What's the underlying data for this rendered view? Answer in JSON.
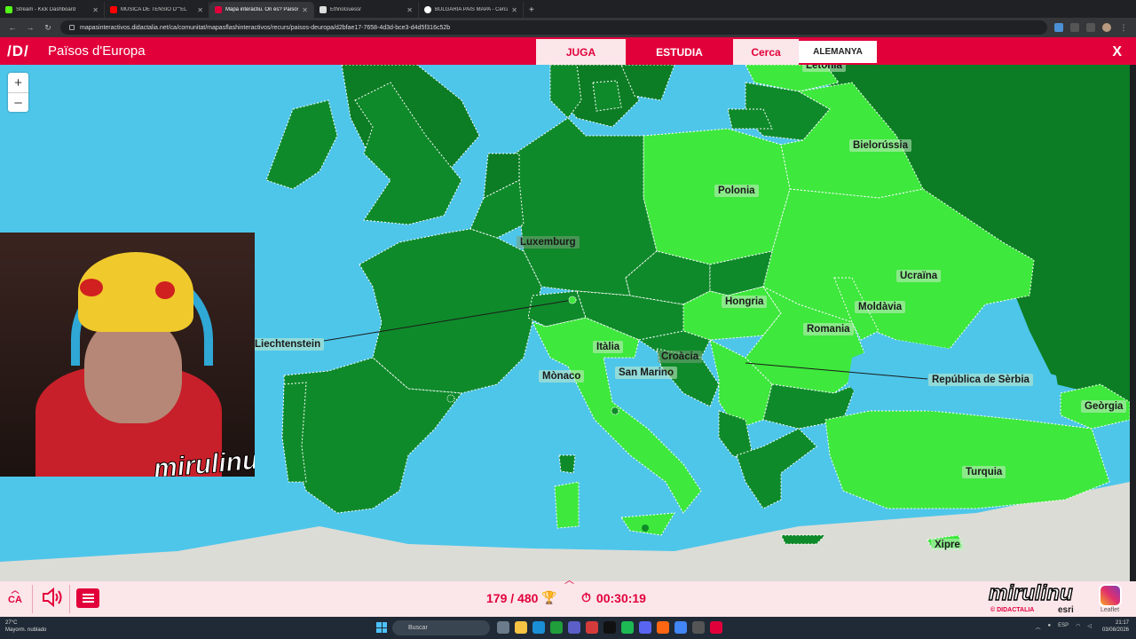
{
  "browser": {
    "tabs": [
      {
        "title": "Stream - Kick Dashboard",
        "color": "#53fc18",
        "active": false
      },
      {
        "title": "MÚSICA DE TENSIÓ D\"\"EL",
        "color": "#ff0000",
        "active": false
      },
      {
        "title": "Mapa interactiu. On és? Països",
        "color": "#e2003b",
        "active": true
      },
      {
        "title": "EthnoGuessr",
        "color": "#dddddd",
        "active": false
      },
      {
        "title": "BULGARIA PAÍS MAPA - Cerca",
        "color": "#ffffff",
        "active": false
      }
    ],
    "url": "mapasinteractivos.didactalia.net/ca/comunitat/mapasflashinteractivos/recurs/paisos-deuropa/d2bfae17-7658-4d3d-bce3-d4d5f316c52b"
  },
  "app": {
    "logo": "/D/",
    "title": "Països d'Europa",
    "tabs": {
      "play": "JUGA",
      "study": "ESTUDIA",
      "search": "Cerca"
    },
    "search_value": "ALEMANYA",
    "close": "X"
  },
  "map": {
    "zoom_in": "+",
    "zoom_out": "–",
    "labels": {
      "letonia": "Letònia",
      "bielorussia": "Bielorússia",
      "polonia": "Polonia",
      "luxemburg": "Luxemburg",
      "ucraina": "Ucraïna",
      "hongria": "Hongria",
      "moldavia": "Moldàvia",
      "liechtenstein": "Liechtenstein",
      "italia": "Itàlia",
      "romania": "Romania",
      "croacia": "Croàcia",
      "san_marino": "San Marino",
      "monaco": "Mònaco",
      "serbia": "República de Sèrbia",
      "georgia": "Geòrgia",
      "turquia": "Turquia",
      "xipre": "Xipre"
    },
    "colors": {
      "sea": "#4ec6ea",
      "found": "#3ee83c",
      "target": "#0f8a2a",
      "land_other": "#0c7d24"
    }
  },
  "streamer": {
    "brand": "mirulinu"
  },
  "bottom": {
    "lang": "CA",
    "score": "179 / 480",
    "timer": "00:30:19",
    "watermark": "mirulinu",
    "credit": "© DIDACTALIA",
    "esri": "esri",
    "leaflet": "Leaflet"
  },
  "taskbar": {
    "temp": "27°C",
    "weather": "Mayorm. nublado",
    "search": "Buscar",
    "lang": "ESP",
    "time": "21:17",
    "date": "03/08/2026"
  }
}
